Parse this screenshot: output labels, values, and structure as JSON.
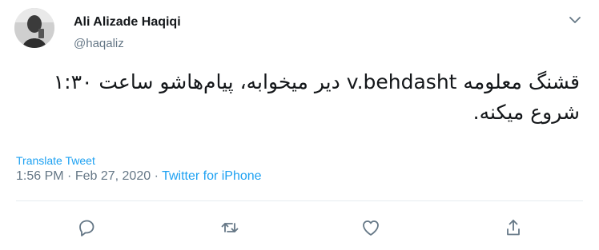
{
  "author": {
    "name": "Ali Alizade Haqiqi",
    "handle": "@haqaliz"
  },
  "tweet": {
    "text": "قشنگ معلومه v.behdasht دیر میخوابه، پیام‌هاشو ساعت ۱:۳۰ شروع میکنه."
  },
  "translate_label": "Translate Tweet",
  "meta": {
    "time": "1:56 PM",
    "separator": "·",
    "date": "Feb 27, 2020",
    "source": "Twitter for iPhone"
  },
  "icons": {
    "more": "chevron-down-icon",
    "reply": "reply-icon",
    "retweet": "retweet-icon",
    "like": "heart-icon",
    "share": "share-icon"
  },
  "colors": {
    "accent": "#1da1f2",
    "secondary_text": "#657786",
    "primary_text": "#14171a"
  }
}
